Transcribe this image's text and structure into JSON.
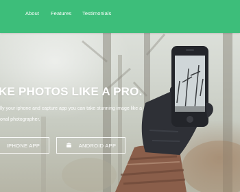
{
  "nav": {
    "links": [
      "About",
      "Features",
      "Testimonials"
    ]
  },
  "hero": {
    "headline": "KE PHOTOS LIKE A PRO.",
    "subtext_line1": "lly your iphone and capture app you can take stunning image like a",
    "subtext_line2": "onal photographer.",
    "buttons": {
      "iphone_label": "IPHONE APP",
      "android_label": "ANDROID APP",
      "android_icon": "android-icon"
    }
  },
  "colors": {
    "nav_background": "#3dbe7a",
    "text": "#ffffff"
  }
}
